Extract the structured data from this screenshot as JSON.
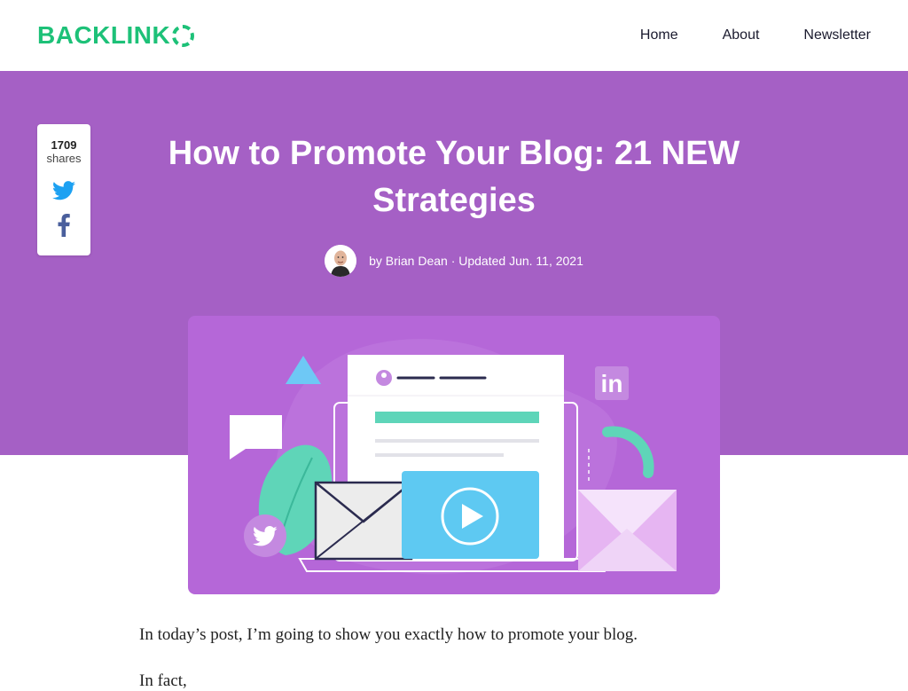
{
  "header": {
    "logo_text": "BACKLINK",
    "nav": [
      {
        "label": "Home"
      },
      {
        "label": "About"
      },
      {
        "label": "Newsletter"
      }
    ]
  },
  "share": {
    "count": "1709",
    "label": "shares",
    "icons": [
      "twitter-icon",
      "facebook-icon"
    ]
  },
  "article": {
    "title": "How to Promote Your Blog: 21 NEW Strategies",
    "byline": "by Brian Dean · Updated Jun. 11, 2021",
    "intro": "In today’s post, I’m going to show you exactly how to promote your blog.",
    "next_partial": "In fact,"
  },
  "colors": {
    "brand_green": "#1dc178",
    "hero_purple": "#a560c5",
    "feature_purple": "#b567d8"
  }
}
